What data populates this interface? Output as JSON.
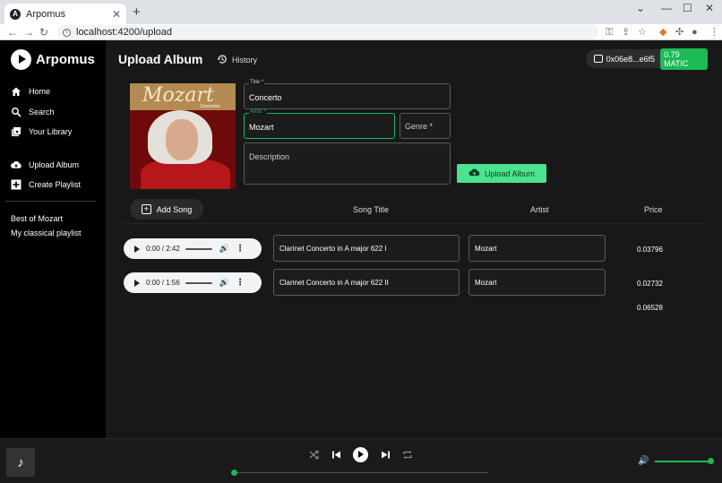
{
  "browser": {
    "tab_title": "Arpomus",
    "url": "localhost:4200/upload"
  },
  "sidebar": {
    "brand": "Arpomus",
    "nav": [
      {
        "label": "Home",
        "icon": "home-icon"
      },
      {
        "label": "Search",
        "icon": "search-icon"
      },
      {
        "label": "Your Library",
        "icon": "library-icon"
      },
      {
        "label": "Upload Album",
        "icon": "cloud-upload-icon"
      },
      {
        "label": "Create Playlist",
        "icon": "plus-box-icon"
      }
    ],
    "playlists": [
      "Best of Mozart",
      "My classical playlist"
    ]
  },
  "header": {
    "title": "Upload Album",
    "history_label": "History",
    "wallet_address": "0x06e8...e6f5",
    "wallet_balance": "0.79 MATIC"
  },
  "cover": {
    "title_text": "Mozart",
    "subtitle_text": "Concertos"
  },
  "form": {
    "title_label": "Title *",
    "title_value": "Concerto",
    "artist_label": "Artist *",
    "artist_value": "Mozart",
    "genre_placeholder": "Genre *",
    "description_placeholder": "Description",
    "upload_button": "Upload Album"
  },
  "songs_table": {
    "add_song_label": "Add Song",
    "headers": {
      "title": "Song Title",
      "artist": "Artist",
      "price": "Price"
    },
    "rows": [
      {
        "time": "0:00 / 2:42",
        "title": "Clarinet Concerto in A major 622 I",
        "artist": "Mozart",
        "price": "0.03796"
      },
      {
        "time": "0:00 / 1:56",
        "title": "Clarinet Concerto in A major 622 II",
        "artist": "Mozart",
        "price": "0.02732"
      }
    ],
    "total": "0.06528"
  },
  "colors": {
    "accent": "#1db954",
    "upload_button": "#4ae38e",
    "background": "#181818",
    "sidebar": "#000000"
  },
  "player": {
    "seek_progress": 0.0,
    "volume_level": 1.0
  }
}
